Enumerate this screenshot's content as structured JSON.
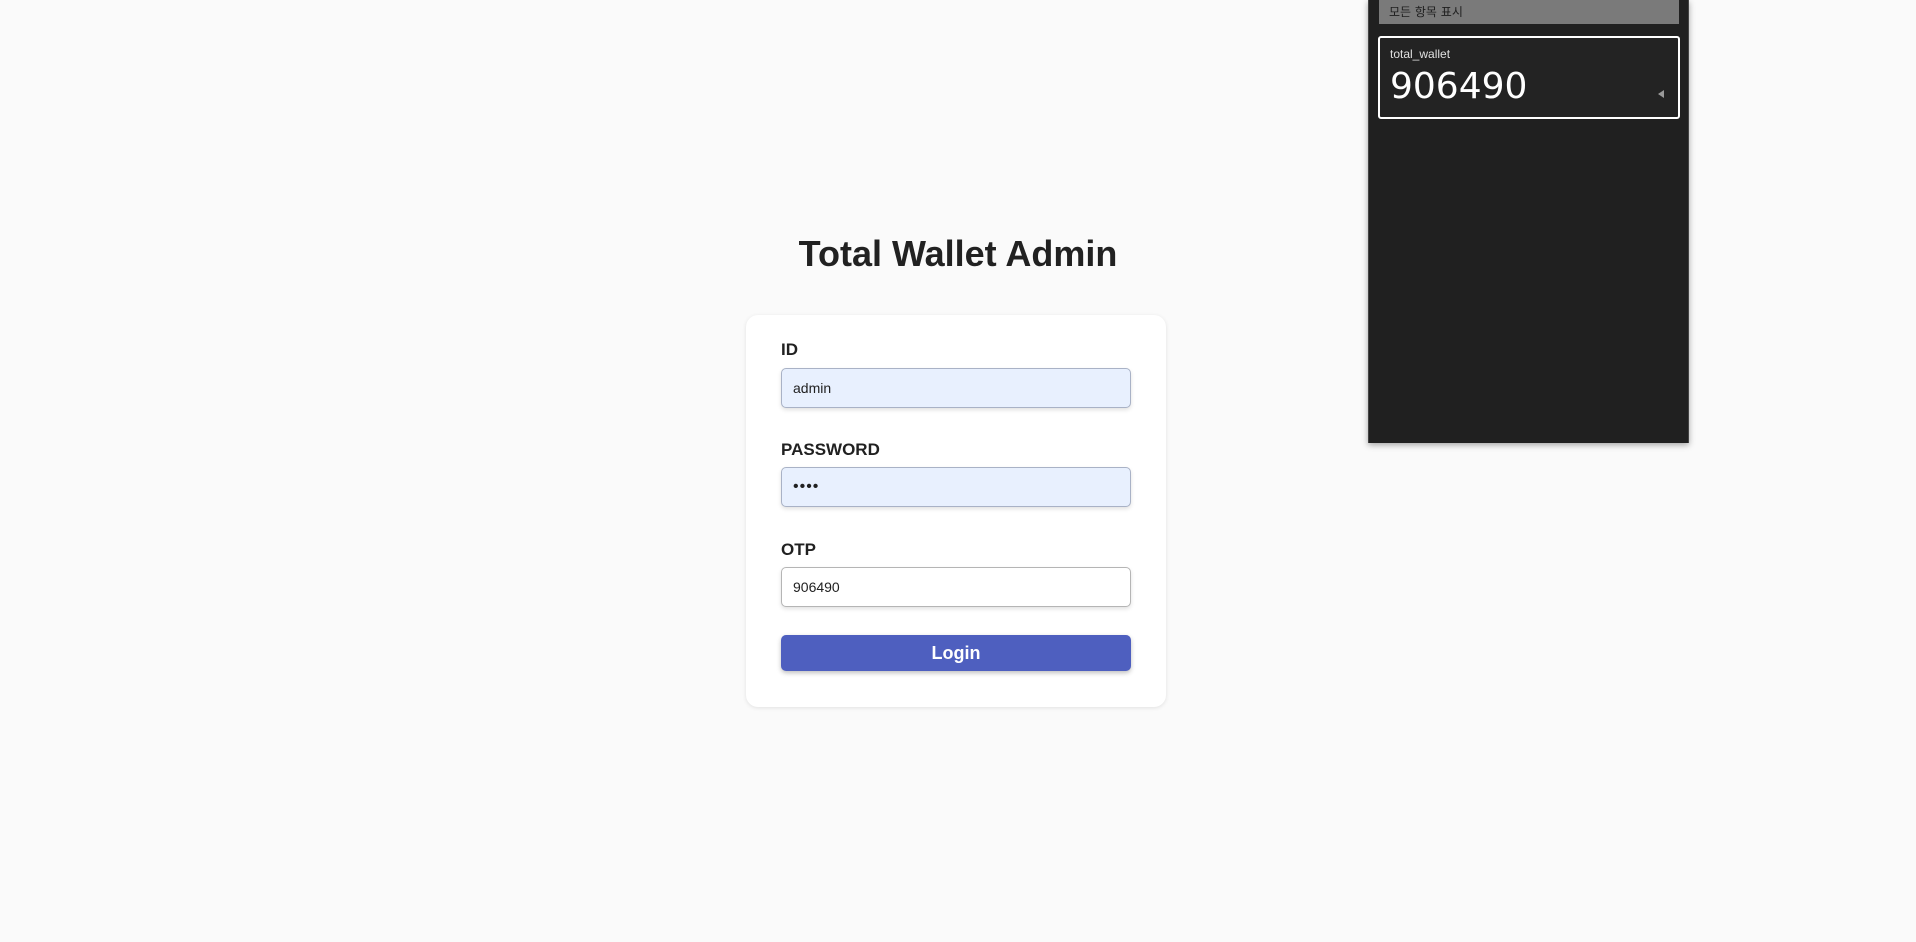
{
  "login": {
    "title": "Total Wallet Admin",
    "id_label": "ID",
    "id_value": "admin",
    "password_label": "PASSWORD",
    "password_value": "••••",
    "otp_label": "OTP",
    "otp_value": "906490",
    "login_button_label": "Login"
  },
  "autofill_popup": {
    "header": "모든 항목 표시",
    "entry": {
      "username": "total_wallet",
      "value": "906490",
      "icon": "chevron-left-icon"
    }
  },
  "colors": {
    "background": "#fafafa",
    "button": "#4e5fbf",
    "autofill_bg": "#e8f0fe",
    "popup_bg": "#202020"
  }
}
